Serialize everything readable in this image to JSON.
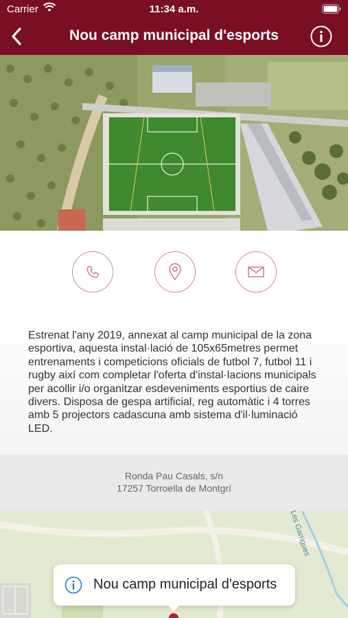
{
  "status_bar": {
    "carrier": "Carrier",
    "time": "11:34 a.m."
  },
  "nav": {
    "title": "Nou camp municipal d'esports",
    "back_icon": "chevron-left-icon",
    "info_icon": "info-circle-icon"
  },
  "actions": {
    "phone_icon": "phone-icon",
    "location_icon": "location-pin-icon",
    "mail_icon": "mail-icon"
  },
  "description": "Estrenat l'any 2019, annexat al camp municipal de la zona esportiva, aquesta instal·lació de 105x65metres permet entrenaments i competicions oficials de futbol 7, futbol 11 i rugby així com completar l'oferta d'instal·lacions municipals per acollir i/o organitzar esdeveniments esportius de caire divers. Disposa de gespa artificial, reg automàtic i 4 torres amb 5 projectors cadascuna amb sistema d'il·luminació LED.",
  "address": {
    "line1": "Ronda Pau Casals, s/n",
    "line2": "17257 Torroella de Montgrí"
  },
  "map": {
    "street_label": "Les Garrigues",
    "callout_title": "Nou camp municipal d'esports"
  },
  "colors": {
    "brand": "#7a0f24",
    "accent_circle": "#c98c96",
    "icon_pink": "#c4727f",
    "callout_info": "#1a7fd4"
  }
}
